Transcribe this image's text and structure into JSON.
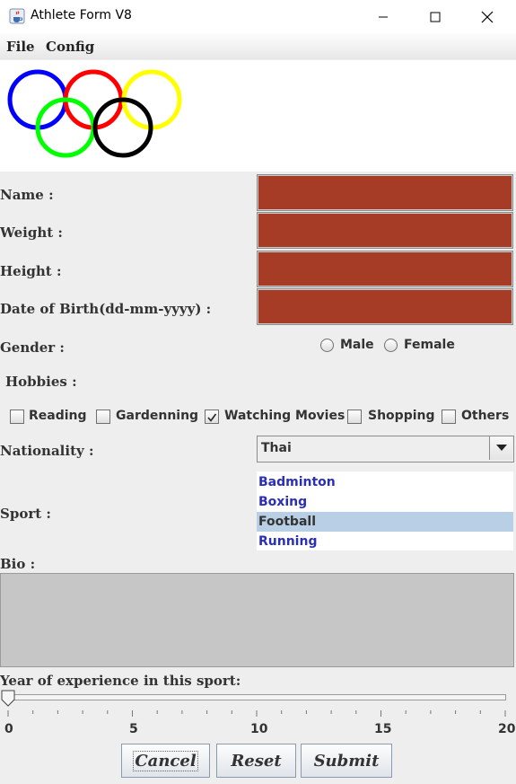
{
  "window": {
    "title": "Athlete Form V8",
    "icon": "java-cup-icon",
    "controls": [
      "minimize-icon",
      "maximize-icon",
      "close-icon"
    ]
  },
  "menu": {
    "items": [
      "File",
      "Config"
    ]
  },
  "logo": {
    "icon": "olympic-rings-icon",
    "ring_colors": [
      "#0000ff",
      "#ff0000",
      "#ffff00",
      "#00ff00",
      "#000000"
    ]
  },
  "form": {
    "name_label": "Name :",
    "weight_label": "Weight :",
    "height_label": "Height :",
    "dob_label": "Date of Birth(dd-mm-yyyy) :",
    "field_color": "#a63c26",
    "gender_label": "Gender :",
    "gender_options": [
      "Male",
      "Female"
    ],
    "hobbies_label": "Hobbies :",
    "hobbies": [
      {
        "label": "Reading",
        "checked": false
      },
      {
        "label": "Gardenning",
        "checked": false
      },
      {
        "label": "Watching Movies",
        "checked": true
      },
      {
        "label": "Shopping",
        "checked": false
      },
      {
        "label": "Others",
        "checked": false
      }
    ],
    "nationality_label": "Nationality :",
    "nationality_value": "Thai",
    "sport_label": "Sport :",
    "sports": [
      "Badminton",
      "Boxing",
      "Football",
      "Running"
    ],
    "sport_selected": "Football",
    "bio_label": "Bio :",
    "experience_label": "Year of experience in this sport:",
    "experience_value": 0,
    "slider_ticks": [
      "0",
      "5",
      "10",
      "15",
      "20"
    ]
  },
  "buttons": {
    "cancel": "Cancel",
    "reset": "Reset",
    "submit": "Submit"
  }
}
